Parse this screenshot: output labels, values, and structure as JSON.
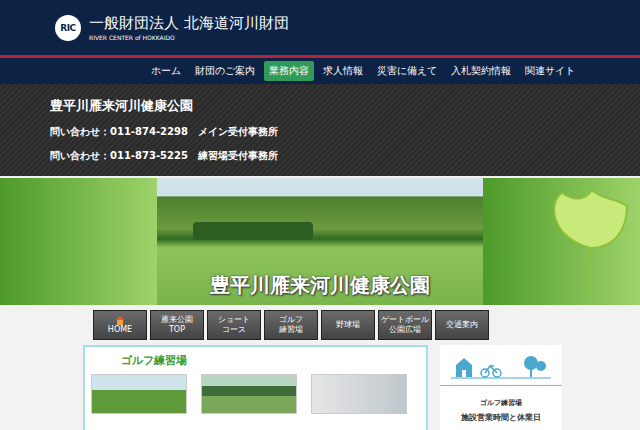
{
  "header": {
    "logo": "RIC",
    "org": "一般財団法人 北海道河川財団",
    "org_en": "RIVER CENTER of HOKKAIDO"
  },
  "nav": [
    {
      "label": "ホーム",
      "selected": false
    },
    {
      "label": "財団のご案内",
      "selected": false
    },
    {
      "label": "業務内容",
      "selected": true
    },
    {
      "label": "求人情報",
      "selected": false
    },
    {
      "label": "災害に備えて",
      "selected": false
    },
    {
      "label": "入札契約情報",
      "selected": false
    },
    {
      "label": "関連サイト",
      "selected": false
    }
  ],
  "park": {
    "title": "豊平川雁来河川健康公園",
    "contacts": [
      {
        "label": "問い合わせ：011-874-2298",
        "office": "メイン受付事務所"
      },
      {
        "label": "問い合わせ：011-873-5225",
        "office": "練習場受付事務所"
      }
    ]
  },
  "banner": {
    "title": "豊平川雁来河川健康公園"
  },
  "tabs": [
    {
      "kind": "home",
      "lines": [
        "HOME"
      ]
    },
    {
      "kind": "text",
      "lines": [
        "雁来公園",
        "TOP"
      ]
    },
    {
      "kind": "text",
      "lines": [
        "ショート",
        "コース"
      ]
    },
    {
      "kind": "text",
      "lines": [
        "ゴルフ",
        "練習場"
      ]
    },
    {
      "kind": "text",
      "lines": [
        "野球場"
      ]
    },
    {
      "kind": "text",
      "lines": [
        "ゲートボール",
        "公園広場"
      ]
    },
    {
      "kind": "text",
      "lines": [
        "交通案内"
      ]
    }
  ],
  "section": {
    "title": "ゴルフ練習場"
  },
  "sidebar": {
    "title": "ゴルフ練習場",
    "subtitle": "施設営業時間と休業日"
  }
}
